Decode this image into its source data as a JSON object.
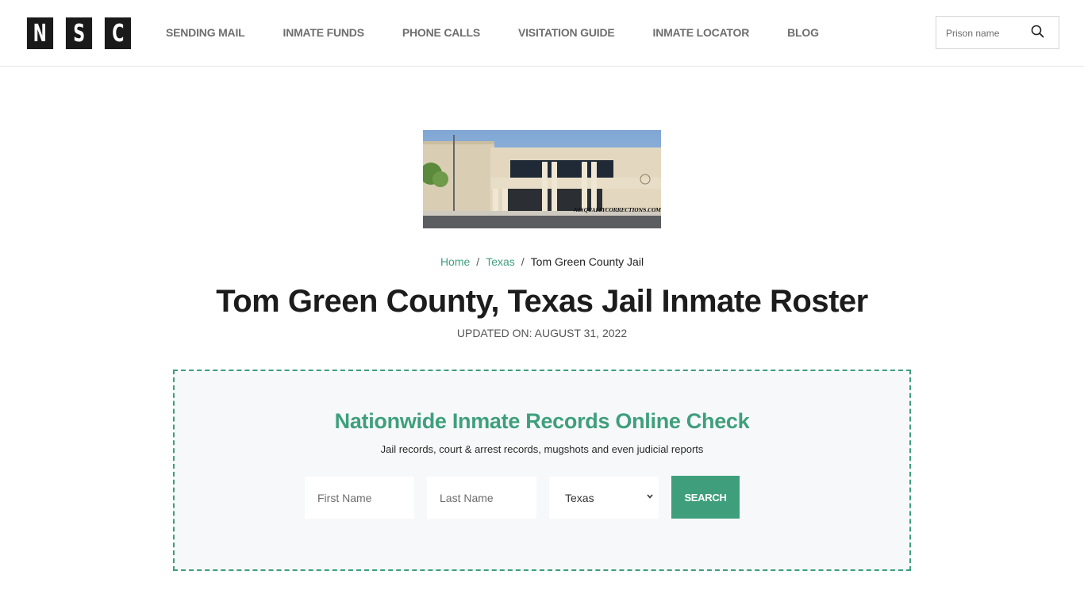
{
  "header": {
    "logo_letters": [
      "N",
      "S",
      "C"
    ],
    "nav": [
      {
        "label": "SENDING MAIL"
      },
      {
        "label": "INMATE FUNDS"
      },
      {
        "label": "PHONE CALLS"
      },
      {
        "label": "VISITATION GUIDE"
      },
      {
        "label": "INMATE LOCATOR"
      },
      {
        "label": "BLOG"
      }
    ],
    "search": {
      "placeholder": "Prison name",
      "icon": "search-icon"
    }
  },
  "hero": {
    "image_alt": "Tom Green County Jail building",
    "watermark": "NISQUALLYCORRECTIONS.COM"
  },
  "breadcrumb": {
    "items": [
      {
        "label": "Home"
      },
      {
        "label": "Texas"
      }
    ],
    "separator": "/",
    "current": "Tom Green County Jail"
  },
  "page": {
    "title": "Tom Green County, Texas Jail Inmate Roster",
    "updated": "UPDATED ON: AUGUST 31, 2022"
  },
  "records_check": {
    "title": "Nationwide Inmate Records Online Check",
    "subtitle": "Jail records, court & arrest records, mugshots and even judicial reports",
    "first_name_placeholder": "First Name",
    "last_name_placeholder": "Last Name",
    "state_selected": "Texas",
    "search_label": "SEARCH"
  },
  "colors": {
    "accent": "#3f9f7c",
    "logo_bg": "#1a1a1a",
    "nav_text": "#6e6e6e",
    "box_bg": "#f6f8f9"
  }
}
